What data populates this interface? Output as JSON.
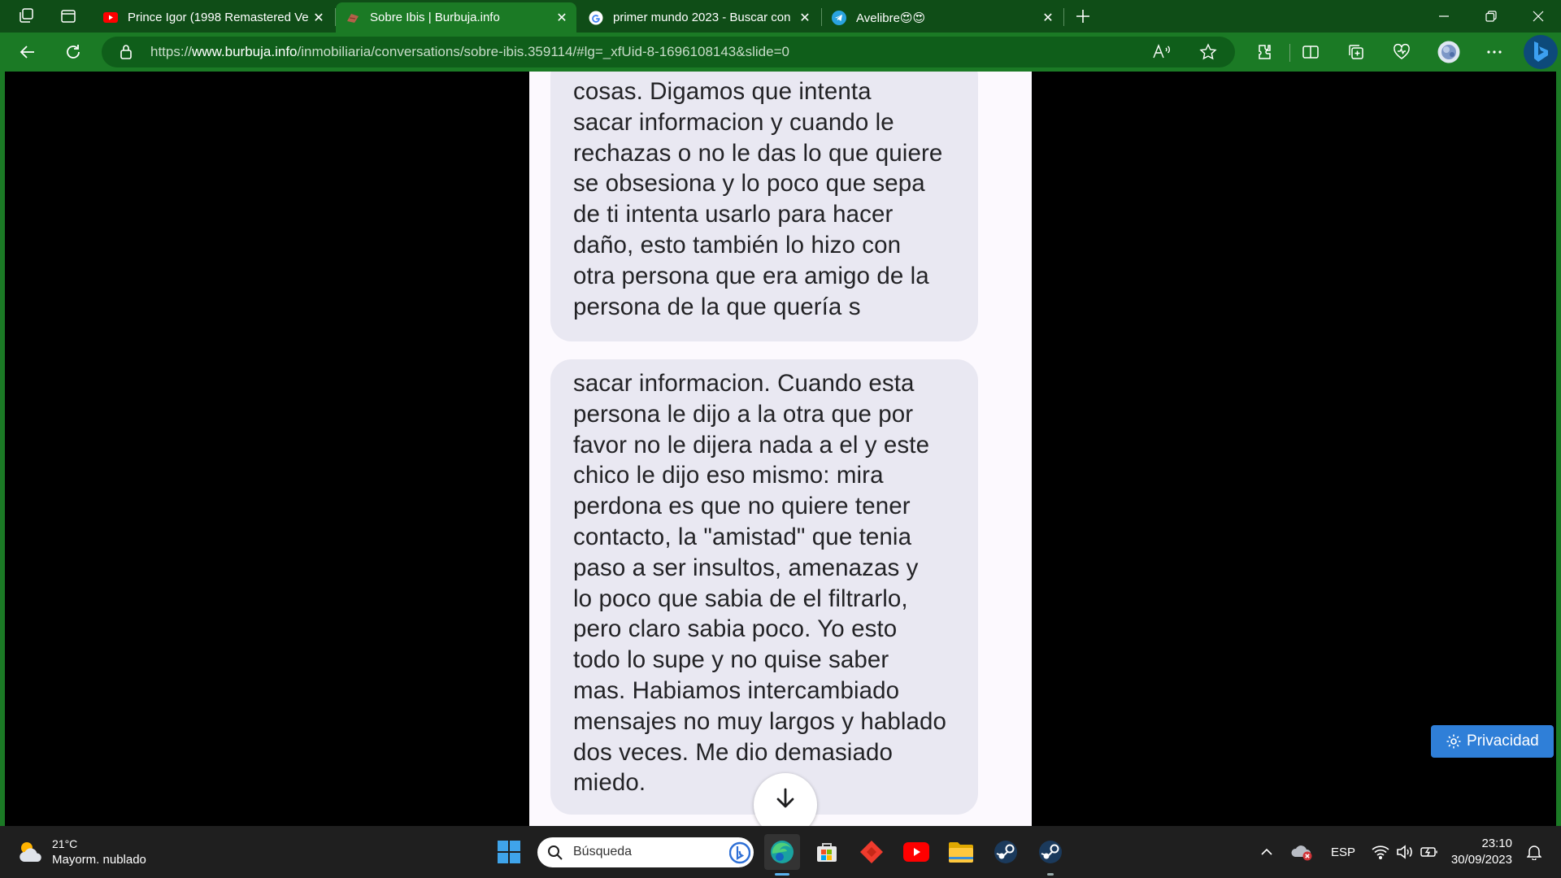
{
  "browser": {
    "tabs": [
      {
        "title": "Prince Igor (1998 Remastered Ve",
        "favicon": "youtube-icon",
        "active": false
      },
      {
        "title": "Sobre Ibis | Burbuja.info",
        "favicon": "burbuja-icon",
        "active": true
      },
      {
        "title": "primer mundo 2023 - Buscar con",
        "favicon": "google-icon",
        "active": false
      },
      {
        "title": "Avelibre😍😍",
        "favicon": "telegram-icon",
        "active": false
      }
    ],
    "url": {
      "scheme": "https://",
      "host": "www.burbuja.info",
      "path": "/inmobiliaria/conversations/sobre-ibis.359114/#lg=_xfUid-8-1696108143&slide=0"
    }
  },
  "messages": [
    {
      "text": "cosas. Digamos que intenta\nsacar informacion y cuando le\nrechazas o no le das lo que quiere\nse obsesiona y lo poco que sepa\nde ti intenta usarlo para hacer\ndaño, esto también lo hizo con\notra persona que era amigo de la\npersona de la que quería s"
    },
    {
      "text": "sacar informacion. Cuando esta\npersona le dijo a la otra que por\nfavor no le dijera nada a el y este\nchico le dijo eso mismo: mira\nperdona es que no quiere tener\ncontacto, la \"amistad\" que tenia\npaso a ser insultos, amenazas y\nlo poco que sabia de el filtrarlo,\npero claro sabia poco. Yo esto\ntodo lo supe y no quise saber\nmas. Habiamos intercambiado\nmensajes no muy largos y hablado\ndos veces. Me dio demasiado\nmiedo."
    }
  ],
  "privacy_button": "Privacidad",
  "taskbar": {
    "weather_temp": "21°C",
    "weather_desc": "Mayorm. nublado",
    "search_placeholder": "Búsqueda",
    "language": "ESP",
    "time": "23:10",
    "date": "30/09/2023"
  },
  "colors": {
    "browser_frame": "#1b7a25",
    "tab_strip": "#0f4d17",
    "bubble": "#e9e8f2",
    "privacy_button": "#2f7fd8"
  }
}
